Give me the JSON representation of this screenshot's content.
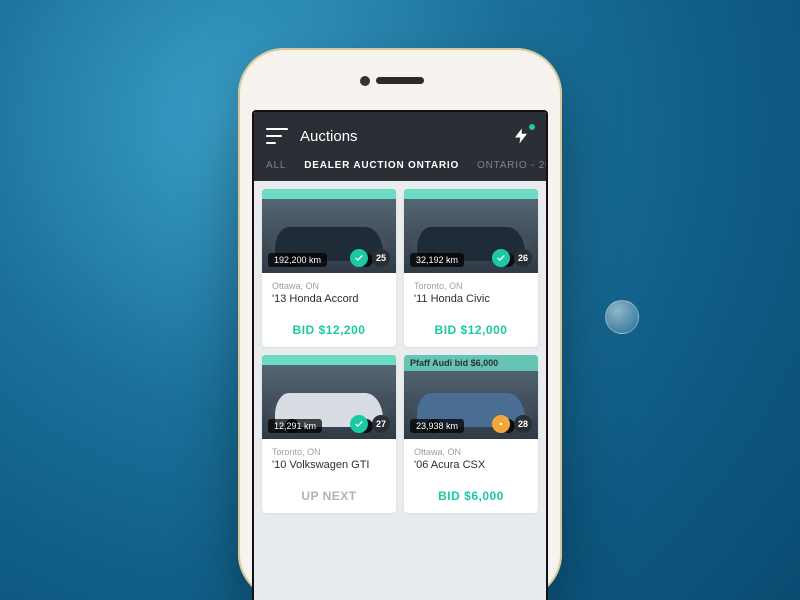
{
  "header": {
    "title": "Auctions"
  },
  "tabs": [
    {
      "label": "ALL",
      "active": false
    },
    {
      "label": "DEALER AUCTION ONTARIO",
      "active": true
    },
    {
      "label": "ONTARIO - 20",
      "active": false
    }
  ],
  "listings": [
    {
      "km": "192,200 km",
      "location": "Ottawa, ON",
      "title": "'13 Honda Accord",
      "bid_label": "BID $12,200",
      "bid_style": "teal",
      "count": "25",
      "status": "green"
    },
    {
      "km": "32,192 km",
      "location": "Toronto, ON",
      "title": "'11 Honda Civic",
      "bid_label": "BID $12,000",
      "bid_style": "teal",
      "count": "26",
      "status": "green"
    },
    {
      "km": "12,291 km",
      "location": "Toronto, ON",
      "title": "'10 Volkswagen GTI",
      "bid_label": "UP NEXT",
      "bid_style": "gray",
      "count": "27",
      "status": "green"
    },
    {
      "km": "23,938 km",
      "location": "Ottawa, ON",
      "title": "'06 Acura CSX",
      "bid_label": "BID $6,000",
      "bid_style": "teal",
      "count": "28",
      "status": "orange",
      "overlay": "Pfaff Audi bid $6,000"
    }
  ]
}
